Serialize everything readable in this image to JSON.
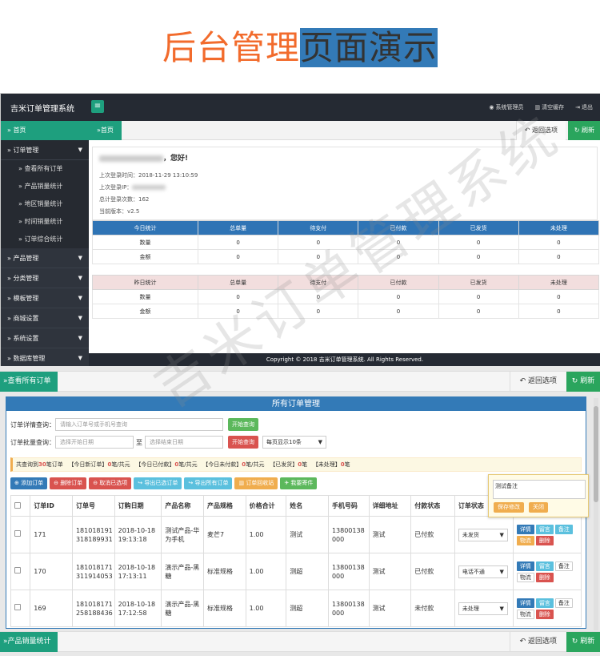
{
  "promo": {
    "title_a": "后台管理",
    "title_b": "页面演示"
  },
  "app": {
    "brand": "吉米订单管理系统",
    "menu_toggle": "≡"
  },
  "topnav": [
    {
      "icon": "user-icon",
      "label": "系统管理员"
    },
    {
      "icon": "trash-icon",
      "label": "清空缓存"
    },
    {
      "icon": "logout-icon",
      "label": "退出"
    }
  ],
  "sidebar": {
    "home": "» 首页",
    "order_mgmt": "» 订单管理",
    "order_sub": [
      "» 查看所有订单",
      "» 产品销量统计",
      "» 地区销量统计",
      "» 时间销量统计",
      "» 订单综合统计"
    ],
    "items": [
      "» 产品管理",
      "» 分类管理",
      "» 模板管理",
      "» 商城设置",
      "» 系统设置",
      "» 数据库管理"
    ]
  },
  "tabs1": {
    "home": "»首页",
    "back": "返回选项",
    "refresh": "刷新"
  },
  "welcome": {
    "greet": "，您好!",
    "last_login_time": "上次登录时间：2018-11-29 13:10:59",
    "last_login_ip": "上次登录IP：",
    "login_count": "总计登录次数：162",
    "version": "当前版本：v2.5"
  },
  "today_stat": {
    "headers": [
      "今日统计",
      "总单量",
      "待支付",
      "已付款",
      "已发货",
      "未处理"
    ],
    "rows": [
      [
        "数量",
        "0",
        "0",
        "0",
        "0",
        "0"
      ],
      [
        "金额",
        "0",
        "0",
        "0",
        "0",
        "0"
      ]
    ]
  },
  "yesterday_stat": {
    "headers": [
      "昨日统计",
      "总单量",
      "待支付",
      "已付款",
      "已发货",
      "未处理"
    ],
    "rows": [
      [
        "数量",
        "0",
        "0",
        "0",
        "0",
        "0"
      ],
      [
        "金额",
        "0",
        "0",
        "0",
        "0",
        "0"
      ]
    ]
  },
  "footer": "Copyright © 2018 吉米订单管理系统. All Rights Reserved.",
  "watermark": "吉米订单管理系统",
  "tabs2": {
    "active": "»查看所有订单",
    "back": "返回选项",
    "refresh": "刷新"
  },
  "panel": {
    "title": "所有订单管理",
    "detail_query_label": "订单详情查询：",
    "detail_query_placeholder": "请输入订单号或手机号查询",
    "start_query": "开始查询",
    "batch_query_label": "订单批量查询：",
    "start_date_placeholder": "选择开始日期",
    "to": "至",
    "end_date_placeholder": "选择结束日期",
    "page_size": "每页显示10条"
  },
  "notice": {
    "total_prefix": "共查询到",
    "total_count": "30",
    "total_suffix": "笔订单",
    "today_new_label": "【今日新订单】",
    "today_new_count": "0",
    "today_new_suffix": "笔/共元",
    "today_paid_label": "【今日已付款】",
    "today_paid_count": "0",
    "today_paid_suffix": "笔/共元",
    "today_unpaid_label": "【今日未付款】",
    "today_unpaid_count": "0",
    "today_unpaid_suffix": "笔/共元",
    "shipped_label": "【已发货】",
    "shipped_count": "0",
    "shipped_suffix": "笔",
    "unprocessed_label": "【未处理】",
    "unprocessed_count": "0",
    "unprocessed_suffix": "笔"
  },
  "toolbar": [
    "添加订单",
    "删除订单",
    "取消已选项",
    "导出已选订单",
    "导出所有订单",
    "订单回收站",
    "我要寄件"
  ],
  "table": {
    "headers": [
      "订单ID",
      "订单号",
      "订购日期",
      "产品名称",
      "产品规格",
      "价格合计",
      "姓名",
      "手机号码",
      "详细地址",
      "付款状态",
      "订单状态",
      "操作"
    ],
    "rows": [
      {
        "id": "171",
        "no": "181018191318189931",
        "date": "2018-10-18 19:13:18",
        "product": "测试产品-华为手机",
        "spec": "麦芒7",
        "price": "1.00",
        "name": "测试",
        "phone": "13800138000",
        "addr": "测试",
        "pay": "已付款",
        "status": "未发货"
      },
      {
        "id": "170",
        "no": "181018171311914053",
        "date": "2018-10-18 17:13:11",
        "product": "演示产品-黑糖",
        "spec": "标准规格",
        "price": "1.00",
        "name": "测超",
        "phone": "13800138000",
        "addr": "测试",
        "pay": "已付款",
        "status": "电话不通"
      },
      {
        "id": "169",
        "no": "181018171258188436",
        "date": "2018-10-18 17:12:58",
        "product": "演示产品-黑糖",
        "spec": "标准规格",
        "price": "1.00",
        "name": "测超",
        "phone": "13800138000",
        "addr": "测试",
        "pay": "未付款",
        "status": "未处理"
      }
    ],
    "ops": {
      "detail": "详情",
      "message": "留言",
      "remark": "备注",
      "logistics": "物流",
      "delete": "删除"
    }
  },
  "popup": {
    "text": "测试备注",
    "save": "保存修改",
    "close": "关闭"
  },
  "tabs3": {
    "active": "»产品销量统计",
    "back": "返回选项",
    "refresh": "刷新"
  }
}
